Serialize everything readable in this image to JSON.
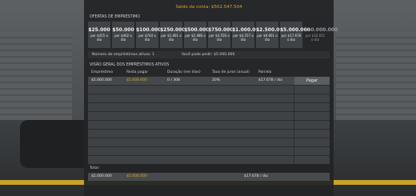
{
  "header": {
    "balance": "Saldo da conta: $502.547.504"
  },
  "offers": {
    "title": "OFERTAS DE EMPRÉSTIMO",
    "items": [
      {
        "amount": "$25.000",
        "rate": "por $455 o dia",
        "enabled": true
      },
      {
        "amount": "$50.000",
        "rate": "por $462 o dia",
        "enabled": true
      },
      {
        "amount": "$100.000",
        "rate": "por $744 o dia",
        "enabled": true
      },
      {
        "amount": "$250.000",
        "rate": "por $1.061 o dia",
        "enabled": true
      },
      {
        "amount": "$500.000",
        "rate": "por $2.486 o dia",
        "enabled": true
      },
      {
        "amount": "$750.000",
        "rate": "por $3.556 o dia",
        "enabled": true
      },
      {
        "amount": "$1.000.000",
        "rate": "por $4.257 o dia",
        "enabled": true
      },
      {
        "amount": "$2.500.000",
        "rate": "por $9.661 o dia",
        "enabled": true
      },
      {
        "amount": "$5.000.000",
        "rate": "por $17.678 o dia",
        "enabled": true
      },
      {
        "amount": "$10.000.000",
        "rate": "por $32.651 o dia",
        "enabled": false
      }
    ]
  },
  "info": {
    "active_count": "Número de empréstimos ativos: 1",
    "can_borrow": "Você pode pedir: $5.000.000"
  },
  "active_loans": {
    "title": "VISÃO GERAL DOS EMPRÉSTIMOS ATIVOS",
    "headers": [
      "Empréstimo",
      "Resta pagar",
      "Duração (em dias)",
      "Taxa de juros (anual)",
      "Parcela"
    ],
    "rows": [
      {
        "loan": "$5.000.000",
        "remaining": "$5.000.000",
        "duration": "0 / 308",
        "rate": "20%",
        "installment": "$17.678 / dia",
        "pay_label": "Pagar"
      }
    ]
  },
  "totals": {
    "label": "Total:",
    "loan": "$5.000.000",
    "remaining": "$5.000.000",
    "installment": "$17.678 / dia"
  },
  "colors": {
    "accent": "#d9a322",
    "panel": "#222426",
    "row": "#46494c"
  }
}
